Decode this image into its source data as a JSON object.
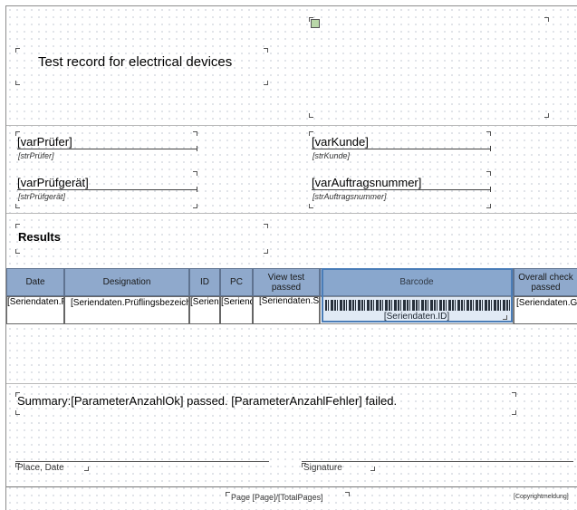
{
  "header": {
    "title": "Test record for electrical devices"
  },
  "info": {
    "tester_var": "[varPrüfer]",
    "tester_str": "[strPrüfer]",
    "device_var": "[varPrüfgerät]",
    "device_str": "[strPrüfgerät]",
    "customer_var": "[varKunde]",
    "customer_str": "[strKunde]",
    "order_var": "[varAuftragsnummer]",
    "order_str": "[strAuftragsnummer]"
  },
  "results": {
    "heading": "Results"
  },
  "table": {
    "headers": {
      "date": "Date",
      "designation": "Designation",
      "id": "ID",
      "pc": "PC",
      "view_test": "View test passed",
      "barcode": "Barcode",
      "overall": "Overall check passed"
    },
    "row": {
      "date": "[Seriendaten.Prüfdatum]",
      "designation": "[Seriendaten.Prüflingsbezeichnung]",
      "id": "[Seriendaten.ID]",
      "pc": "[Seriendaten.SK]",
      "view_test": "[Seriendaten.SichtprüfungOK]",
      "barcode": "[Seriendaten.ID]",
      "overall": "[Seriendaten.GesamtOK]"
    }
  },
  "summary": {
    "text": "Summary:[ParameterAnzahlOk] passed. [ParameterAnzahlFehler] failed."
  },
  "signature": {
    "place_date": "Place, Date",
    "signature": "Signature"
  },
  "footer": {
    "page": "Page [Page]/[TotalPages]",
    "copyright": "[Copyrightmeldung]"
  },
  "colors": {
    "header_fill": "#8fa9cc",
    "selection": "#4a7db8"
  }
}
